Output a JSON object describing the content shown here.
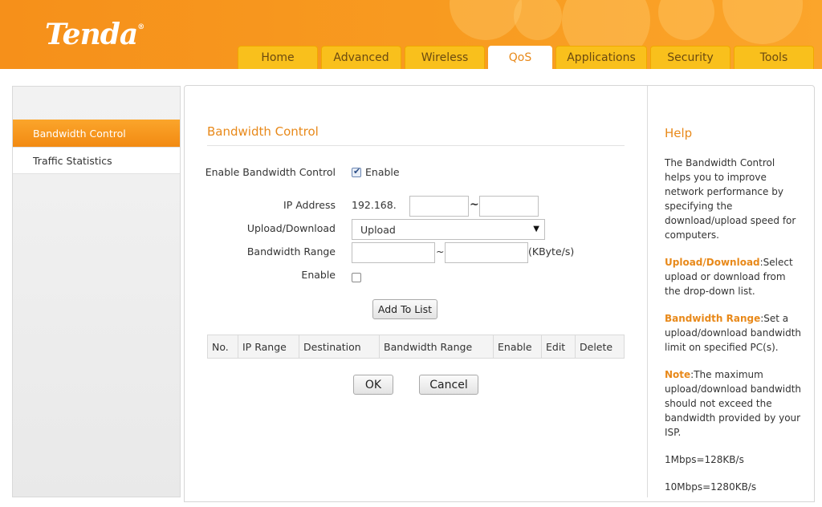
{
  "header": {
    "logo": "Tenda",
    "logo_mark": "®",
    "tabs": [
      "Home",
      "Advanced",
      "Wireless",
      "QoS",
      "Applications",
      "Security",
      "Tools"
    ],
    "active_tab": "QoS"
  },
  "sidebar": {
    "items": [
      "Bandwidth Control",
      "Traffic Statistics"
    ],
    "active": "Bandwidth Control"
  },
  "form": {
    "title": "Bandwidth Control",
    "enable_bw_label": "Enable Bandwidth Control",
    "enable_bw_checked": true,
    "enable_text": "Enable",
    "ip_label": "IP Address",
    "ip_prefix": "192.168.",
    "ip_start": "",
    "ip_end": "",
    "tilde": "~",
    "updown_label": "Upload/Download",
    "updown_value": "Upload",
    "range_label": "Bandwidth Range",
    "range_start": "",
    "range_end": "",
    "range_unit": "(KByte/s)",
    "enable_label": "Enable",
    "enable_checked": false,
    "add_button": "Add To List"
  },
  "table": {
    "headers": [
      "No.",
      "IP Range",
      "Destination",
      "Bandwidth Range",
      "Enable",
      "Edit",
      "Delete"
    ]
  },
  "actions": {
    "ok": "OK",
    "cancel": "Cancel"
  },
  "help": {
    "title": "Help",
    "intro": "The Bandwidth Control helps you to improve network performance by specifying the download/upload speed for computers.",
    "updown_key": "Upload/Download",
    "updown_text": ":Select upload or download from the drop-down list.",
    "range_key": "Bandwidth Range",
    "range_text": ":Set a upload/download bandwidth limit on specified PC(s).",
    "note_key": "Note",
    "note_text": ":The maximum upload/download bandwidth should not exceed the bandwidth provided by your ISP.",
    "conv1": "1Mbps=128KB/s",
    "conv2": "10Mbps=1280KB/s"
  },
  "colors": {
    "brand_orange": "#f6901a",
    "tab_yellow": "#f9c01c",
    "accent_text": "#e8891a"
  }
}
